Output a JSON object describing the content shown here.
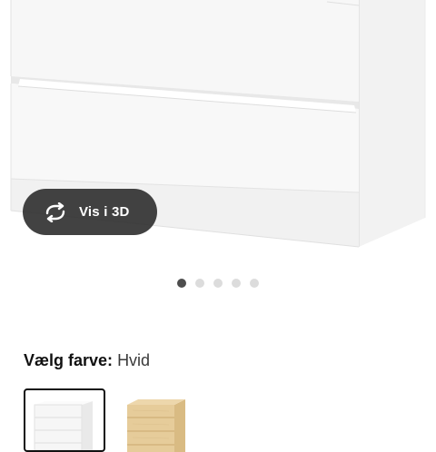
{
  "gallery": {
    "view_3d_label": "Vis i 3D",
    "icon": "rotate-3d-icon",
    "dots": [
      {
        "active": true
      },
      {
        "active": false
      },
      {
        "active": false
      },
      {
        "active": false
      },
      {
        "active": false
      }
    ]
  },
  "color_selector": {
    "label": "Vælg farve:",
    "selected_value": "Hvid",
    "swatches": [
      {
        "name": "white",
        "selected": true,
        "color": "#ffffff"
      },
      {
        "name": "oak-veneer",
        "selected": false,
        "color": "#e2c896"
      }
    ]
  },
  "colors": {
    "button_bg": "#282828",
    "dot_active": "#4d4d4d",
    "dot_inactive": "#dcdcdc"
  }
}
